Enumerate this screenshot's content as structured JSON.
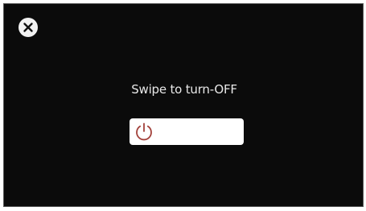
{
  "colors": {
    "screen_background": "#0b0b0b",
    "text": "#e8e8e8",
    "slider_track": "#ffffff",
    "power_icon": "#a2403a",
    "close_icon_bg": "#f2f2f2",
    "close_icon_x": "#111111"
  },
  "close_button": {
    "icon": "close-icon"
  },
  "prompt": {
    "text": "Swipe to turn-OFF"
  },
  "slider": {
    "handle_icon": "power-icon",
    "progress": 0
  }
}
